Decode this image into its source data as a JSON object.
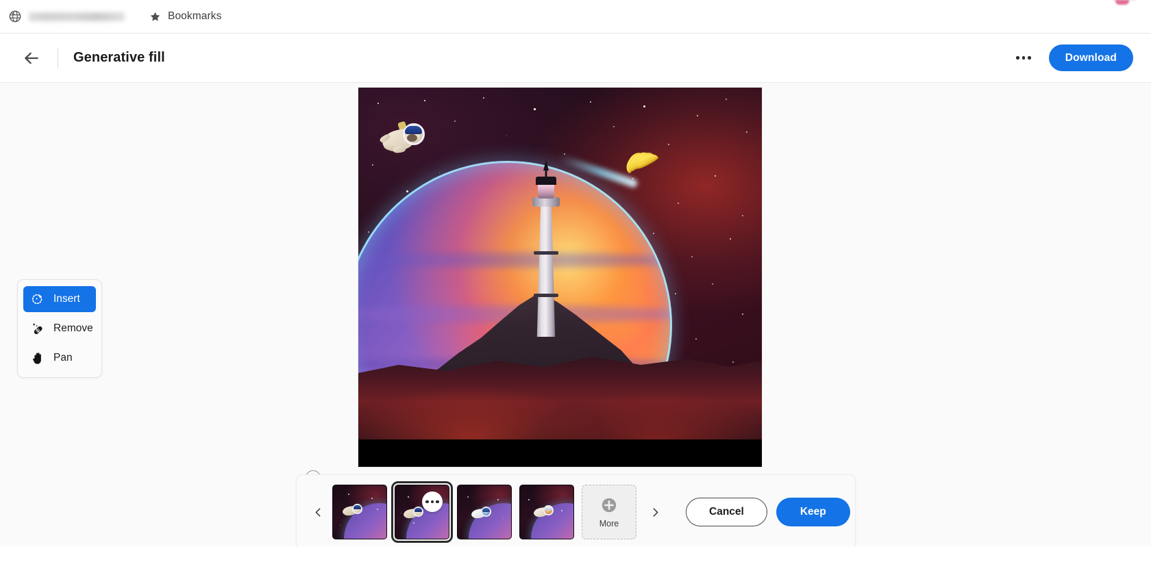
{
  "browser": {
    "globe_icon": "globe-icon",
    "redacted_bookmark": "",
    "star_icon": "star-icon",
    "bookmarks_label": "Bookmarks"
  },
  "header": {
    "back_icon": "back-arrow-icon",
    "title": "Generative fill",
    "more_icon": "overflow-menu-icon",
    "download_label": "Download"
  },
  "tools": {
    "items": [
      {
        "label": "Insert",
        "icon": "sparkle-circle-icon",
        "active": true
      },
      {
        "label": "Remove",
        "icon": "healing-brush-icon",
        "active": false
      },
      {
        "label": "Pan",
        "icon": "hand-icon",
        "active": false
      }
    ]
  },
  "canvas": {
    "description": "Astronaut dog floating in space above a lighthouse on a rocky outcrop with a large gradient planet and a bunch of bananas trailing a comet tail",
    "brush_cursor": "brush-cursor"
  },
  "filmstrip": {
    "prev_icon": "chevron-left-icon",
    "next_icon": "chevron-right-icon",
    "variations": [
      {
        "id": "variation-1",
        "alt": "astronaut pug variation 1",
        "selected": false
      },
      {
        "id": "variation-2",
        "alt": "astronaut pug variation 2",
        "selected": true
      },
      {
        "id": "variation-3",
        "alt": "astronaut dog variation 3",
        "selected": false
      },
      {
        "id": "variation-4",
        "alt": "astronaut dog variation 4",
        "selected": false
      }
    ],
    "selected_badge_icon": "options-dots-icon",
    "more": {
      "label": "More",
      "icon": "plus-circle-icon"
    },
    "cancel_label": "Cancel",
    "keep_label": "Keep"
  },
  "colors": {
    "accent_blue": "#1473e6",
    "canvas_bg": "#fafafa",
    "text_primary": "#1b1b1b"
  }
}
